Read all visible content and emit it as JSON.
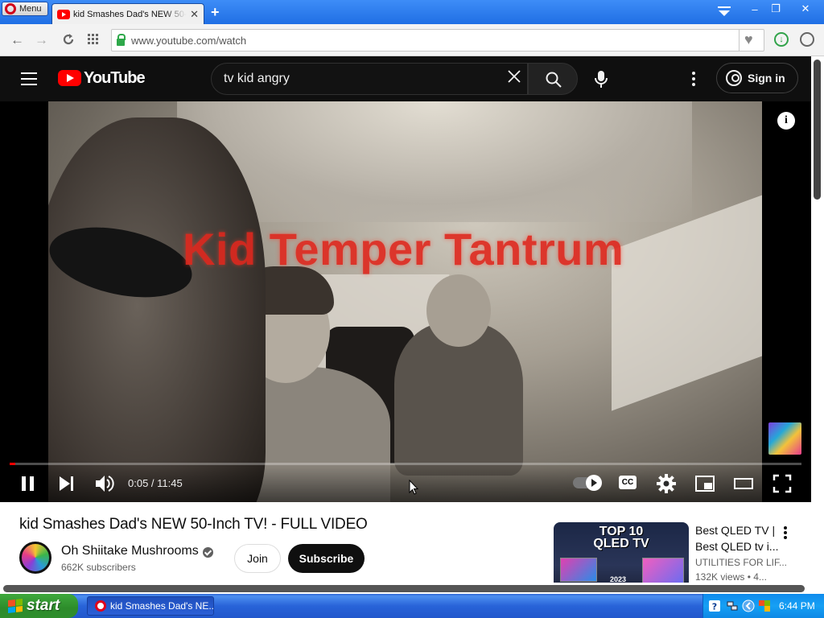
{
  "browser": {
    "menu_label": "Menu",
    "tab_title": "kid Smashes Dad's NEW 50-Inch TV! - FULL VIDEO",
    "tab_close": "✕",
    "new_tab": "+",
    "url": "www.youtube.com/watch",
    "window_minimize": "‒",
    "window_restore": "❐",
    "window_close": "✕"
  },
  "youtube": {
    "logo_text": "YouTube",
    "search": {
      "value": "tv kid angry",
      "placeholder": "Search"
    },
    "sign_in_label": "Sign in"
  },
  "player": {
    "overlay_title": "Kid Temper Tantrum",
    "info_label": "i",
    "time": "0:05 / 11:45",
    "progress_fraction": 0.007,
    "cc_label": "CC"
  },
  "video": {
    "title": "kid Smashes Dad's NEW 50-Inch TV! - FULL VIDEO",
    "channel_name": "Oh Shiitake Mushrooms",
    "subscribers": "662K subscribers",
    "join_label": "Join",
    "subscribe_label": "Subscribe"
  },
  "recommendation": {
    "thumb_line1": "TOP 10",
    "thumb_line2": "QLED TV",
    "thumb_year": "2023",
    "title_line1": "Best QLED TV |",
    "title_line2": "Best QLED tv i...",
    "channel": "UTILITIES FOR LIF...",
    "meta": "132K views  • 4..."
  },
  "taskbar": {
    "start_label": "start",
    "task_label": "kid Smashes Dad's NE...",
    "clock": "6:44 PM"
  },
  "colors": {
    "youtube_red": "#ff0000",
    "youtube_dark": "#0f0f0f",
    "xp_blue": "#2457d1",
    "xp_green": "#3fa93c"
  }
}
